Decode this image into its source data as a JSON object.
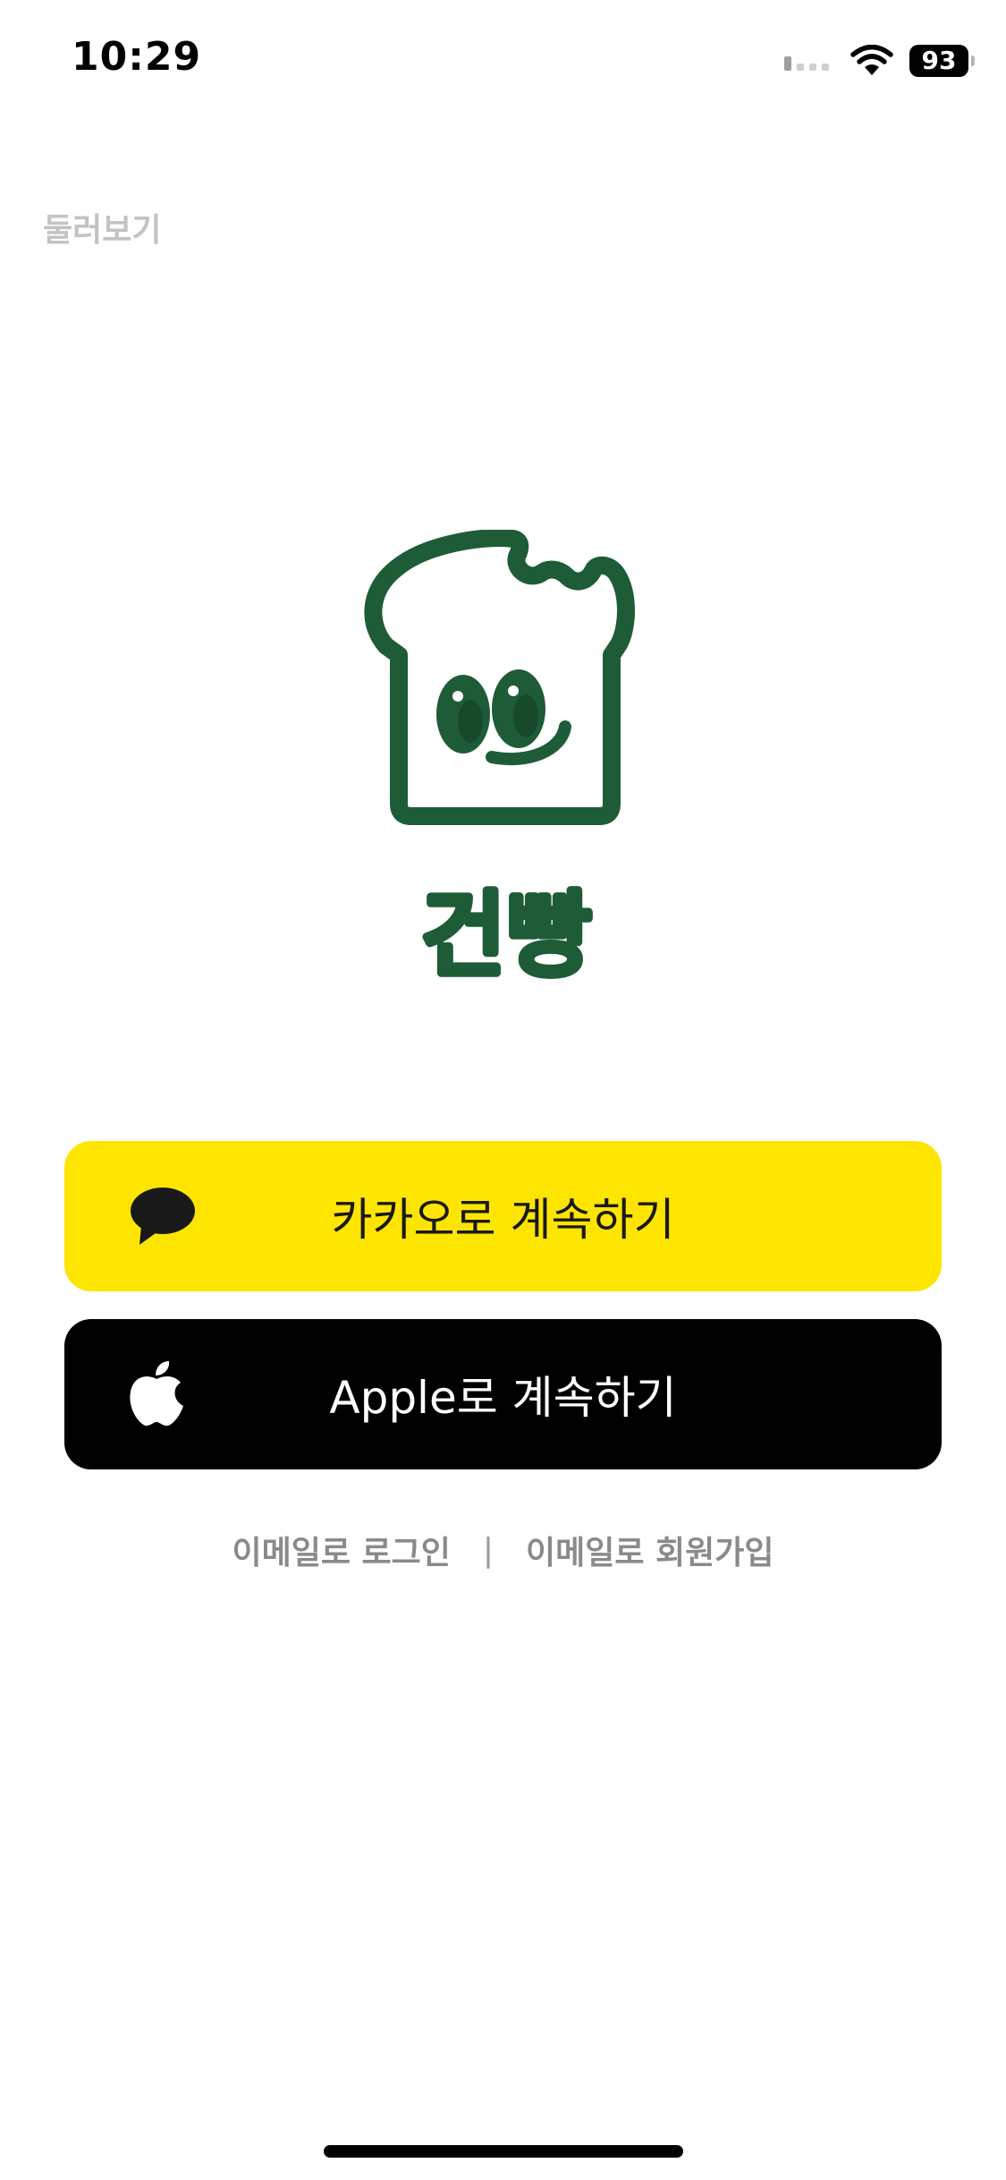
{
  "status_bar": {
    "time": "10:29",
    "battery": "93",
    "icons": [
      "cellular-signal-icon",
      "wifi-icon",
      "battery-icon"
    ]
  },
  "browse_label": "둘러보기",
  "logo": {
    "wordmark": "건빵",
    "brand_color": "#1E5C37"
  },
  "buttons": {
    "kakao": {
      "label": "카카오로 계속하기",
      "icon": "kakao-speech-bubble-icon",
      "background": "#FEE500",
      "text_color": "#191919"
    },
    "apple": {
      "label": "Apple로 계속하기",
      "icon": "apple-logo-icon",
      "background": "#000000",
      "text_color": "#FFFFFF"
    }
  },
  "email_links": {
    "login": "이메일로 로그인",
    "separator": "|",
    "signup": "이메일로 회원가입"
  }
}
